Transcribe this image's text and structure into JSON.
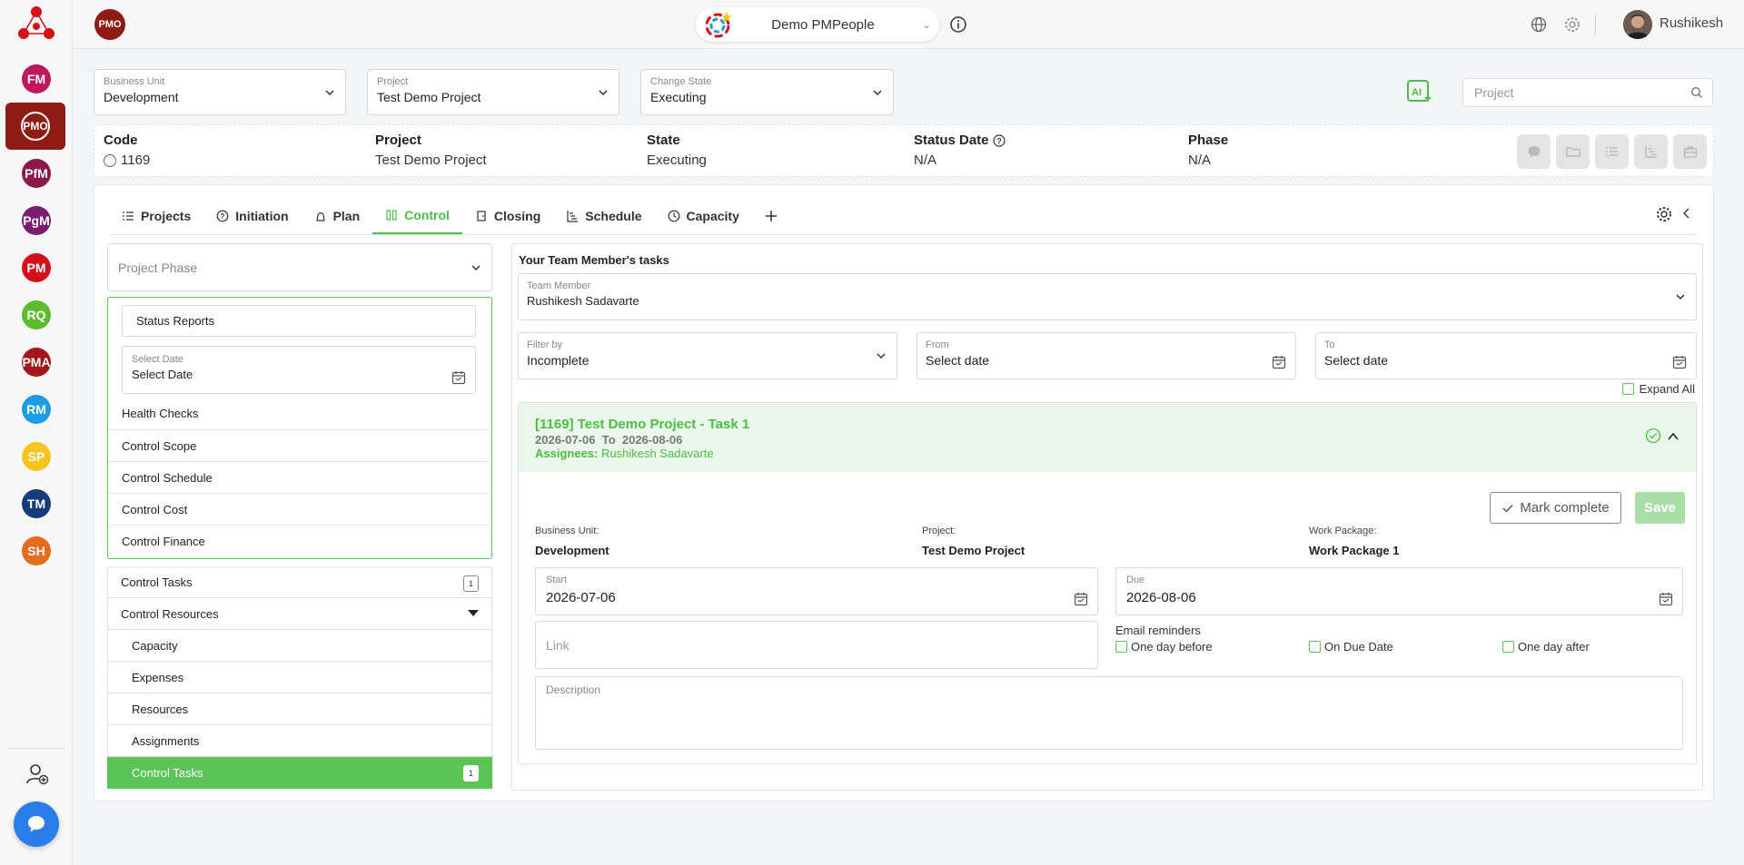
{
  "rail": {
    "items": [
      {
        "label": "FM",
        "color": "#c0165b"
      },
      {
        "label": "PMO",
        "color": "#8e1b14"
      },
      {
        "label": "PfM",
        "color": "#8b1a4a"
      },
      {
        "label": "PgM",
        "color": "#7b1c6e"
      },
      {
        "label": "PM",
        "color": "#d4101b"
      },
      {
        "label": "RQ",
        "color": "#5cbd2c"
      },
      {
        "label": "PMA",
        "color": "#a3171c"
      },
      {
        "label": "RM",
        "color": "#1b9ce3"
      },
      {
        "label": "SP",
        "color": "#f7c520"
      },
      {
        "label": "TM",
        "color": "#153b78"
      },
      {
        "label": "SH",
        "color": "#e56b1f"
      }
    ]
  },
  "topbar": {
    "module_badge": "PMO",
    "org_name": "Demo PMPeople",
    "user_name": "Rushikesh"
  },
  "selectors": {
    "business_unit": {
      "label": "Business Unit",
      "value": "Development"
    },
    "project": {
      "label": "Project",
      "value": "Test Demo Project"
    },
    "change_state": {
      "label": "Change State",
      "value": "Executing"
    },
    "search_placeholder": "Project"
  },
  "info": {
    "code": {
      "label": "Code",
      "value": "1169"
    },
    "project": {
      "label": "Project",
      "value": "Test Demo Project"
    },
    "state": {
      "label": "State",
      "value": "Executing"
    },
    "status_date": {
      "label": "Status Date",
      "value": "N/A"
    },
    "phase": {
      "label": "Phase",
      "value": "N/A"
    }
  },
  "tabs": [
    {
      "label": "Projects",
      "icon": "list-icon"
    },
    {
      "label": "Initiation",
      "icon": "question-circle-icon"
    },
    {
      "label": "Plan",
      "icon": "plan-icon"
    },
    {
      "label": "Control",
      "icon": "control-icon",
      "active": true
    },
    {
      "label": "Closing",
      "icon": "closing-icon"
    },
    {
      "label": "Schedule",
      "icon": "schedule-icon"
    },
    {
      "label": "Capacity",
      "icon": "clock-icon"
    }
  ],
  "left": {
    "phase_placeholder": "Project Phase",
    "status_reports": "Status Reports",
    "select_date_label": "Select Date",
    "select_date_value": "Select Date",
    "group_items": [
      "Health Checks",
      "Control Scope",
      "Control Schedule",
      "Control Cost",
      "Control Finance"
    ],
    "control_tasks": {
      "label": "Control Tasks",
      "count": "1"
    },
    "control_resources": "Control Resources",
    "resources_sub": [
      "Capacity",
      "Expenses",
      "Resources",
      "Assignments"
    ],
    "selected_item": {
      "label": "Control Tasks",
      "count": "1"
    }
  },
  "right": {
    "title": "Your Team Member's tasks",
    "team_member": {
      "label": "Team Member",
      "value": "Rushikesh Sadavarte"
    },
    "filter_by": {
      "label": "Filter by",
      "value": "Incomplete"
    },
    "from": {
      "label": "From",
      "value": "Select date"
    },
    "to": {
      "label": "To",
      "value": "Select date"
    },
    "expand_all": "Expand All",
    "task": {
      "title": "[1169] Test Demo Project - Task 1",
      "dates": "2026-07-06  To  2026-08-06",
      "assignees_label": "Assignees:",
      "assignees_value": "Rushikesh Sadavarte",
      "mark_complete": "Mark complete",
      "save": "Save",
      "business_unit_label": "Business Unit:",
      "business_unit_value": "Development",
      "project_label": "Project:",
      "project_value": "Test Demo Project",
      "work_package_label": "Work Package:",
      "work_package_value": "Work Package 1",
      "start_label": "Start",
      "start_value": "2026-07-06",
      "due_label": "Due",
      "due_value": "2026-08-06",
      "link_placeholder": "Link",
      "email_reminders": "Email reminders",
      "reminder_options": [
        "One day before",
        "On Due Date",
        "One day after"
      ],
      "description_label": "Description"
    }
  },
  "colors": {
    "accent": "#5cc356",
    "brand": "#8e1b14"
  }
}
